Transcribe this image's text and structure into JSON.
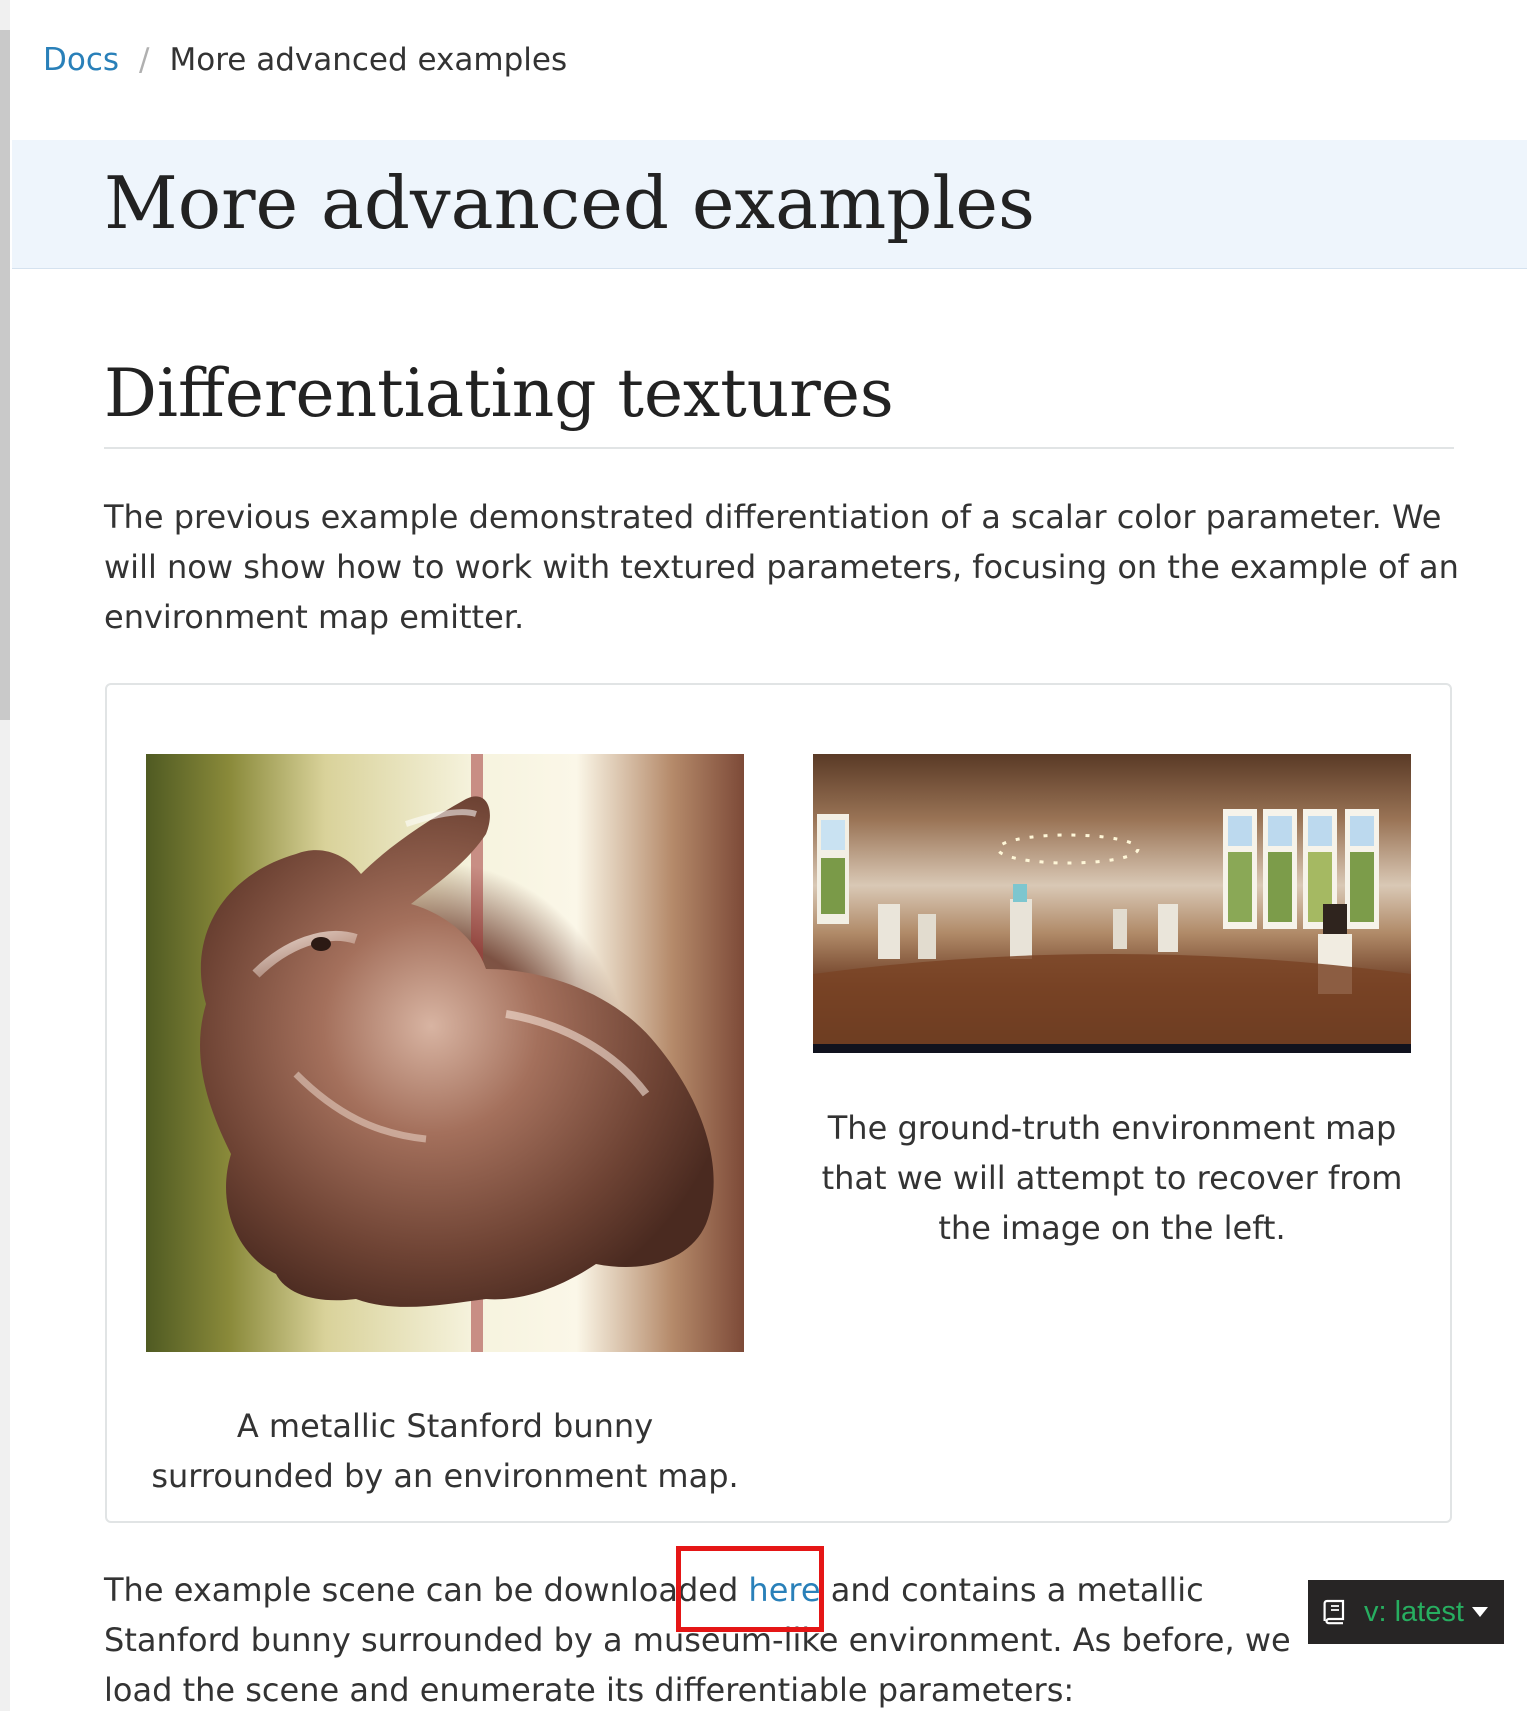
{
  "breadcrumb": {
    "root": "Docs",
    "separator": "/",
    "current": "More advanced examples"
  },
  "page": {
    "title": "More advanced examples"
  },
  "section": {
    "title": "Differentiating textures",
    "intro": "The previous example demonstrated differentiation of a scalar color parameter. We will now show how to work with textured parameters, focusing on the example of an environment map emitter."
  },
  "figure": {
    "left_caption": "A metallic Stanford bunny surrounded by an environment map.",
    "right_caption": "The ground-truth environment map that we will attempt to recover from the image on the left."
  },
  "download_paragraph": {
    "before": "The example scene can be downloaded ",
    "link": "here",
    "after": " and contains a metallic Stanford bunny surrounded by a museum-like environment. As before, we load the scene and enumerate its differentiable parameters:"
  },
  "version_badge": {
    "label": "v: latest",
    "icon": "book-icon"
  },
  "colors": {
    "link": "#2980b9",
    "title_band": "#eef5fc",
    "badge_text": "#27ae60",
    "highlight": "#e51616"
  }
}
